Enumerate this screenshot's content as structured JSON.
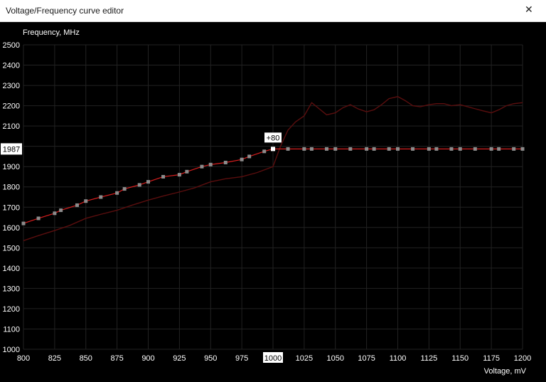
{
  "window": {
    "title": "Voltage/Frequency curve editor",
    "close_icon": "close-icon"
  },
  "chart_data": {
    "type": "line",
    "ylabel": "Frequency, MHz",
    "xlabel": "Voltage, mV",
    "xlim": [
      800,
      1200
    ],
    "ylim": [
      1000,
      2500
    ],
    "x_ticks": [
      800,
      825,
      850,
      875,
      900,
      925,
      950,
      975,
      1000,
      1025,
      1050,
      1075,
      1100,
      1125,
      1150,
      1175,
      1200
    ],
    "y_ticks": [
      1000,
      1100,
      1200,
      1300,
      1400,
      1500,
      1600,
      1700,
      1800,
      1900,
      2000,
      2100,
      2200,
      2300,
      2400,
      2500
    ],
    "grid": true,
    "selected_voltage_label": "1000",
    "selected_frequency_label": "1987",
    "offset_label": "+80",
    "colors": {
      "background": "#000000",
      "grid": "#222222",
      "curve": "#d81e1e",
      "reference_curve": "#5a0e0e",
      "point": "#8c8c8c",
      "selected_point": "#ffffff",
      "axis_text": "#ffffff"
    },
    "series": [
      {
        "role": "edited-curve",
        "x": [
          800,
          812,
          825,
          830,
          843,
          850,
          862,
          875,
          881,
          893,
          900,
          912,
          925,
          931,
          943,
          950,
          962,
          975,
          981,
          993,
          1000,
          1012,
          1025,
          1031,
          1043,
          1050,
          1062,
          1075,
          1081,
          1093,
          1100,
          1112,
          1125,
          1131,
          1143,
          1150,
          1162,
          1175,
          1181,
          1193,
          1200
        ],
        "y": [
          1620,
          1645,
          1670,
          1685,
          1710,
          1730,
          1750,
          1770,
          1790,
          1810,
          1825,
          1850,
          1860,
          1875,
          1900,
          1910,
          1920,
          1935,
          1950,
          1975,
          1987,
          1987,
          1987,
          1987,
          1987,
          1987,
          1987,
          1987,
          1987,
          1987,
          1987,
          1987,
          1987,
          1987,
          1987,
          1987,
          1987,
          1987,
          1987,
          1987,
          1987
        ],
        "selected_index": 20
      },
      {
        "role": "reference-curve",
        "x": [
          800,
          812,
          825,
          837,
          850,
          862,
          875,
          887,
          900,
          912,
          925,
          937,
          950,
          962,
          975,
          987,
          1000,
          1006,
          1012,
          1018,
          1025,
          1031,
          1037,
          1043,
          1050,
          1056,
          1062,
          1068,
          1075,
          1081,
          1087,
          1093,
          1100,
          1106,
          1112,
          1118,
          1125,
          1131,
          1137,
          1143,
          1150,
          1156,
          1162,
          1168,
          1175,
          1181,
          1187,
          1193,
          1200
        ],
        "y": [
          1535,
          1560,
          1585,
          1610,
          1645,
          1665,
          1685,
          1710,
          1735,
          1755,
          1775,
          1795,
          1825,
          1840,
          1850,
          1870,
          1900,
          2000,
          2080,
          2120,
          2150,
          2215,
          2185,
          2155,
          2165,
          2190,
          2205,
          2185,
          2170,
          2180,
          2205,
          2235,
          2245,
          2225,
          2200,
          2195,
          2205,
          2210,
          2210,
          2200,
          2205,
          2195,
          2185,
          2175,
          2165,
          2180,
          2200,
          2210,
          2215
        ]
      }
    ]
  }
}
